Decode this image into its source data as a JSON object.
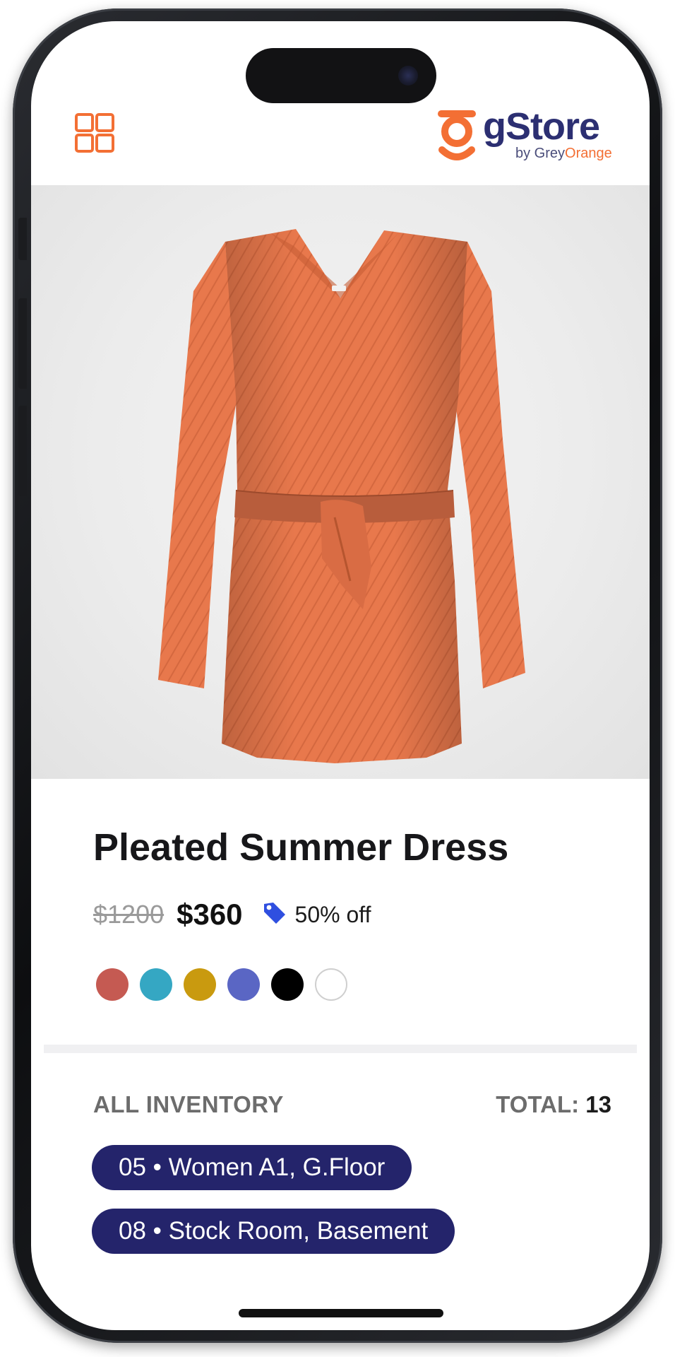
{
  "header": {
    "menu_icon": "grid-icon",
    "logo": {
      "wordmark": "gStore",
      "sub_prefix": "by Grey",
      "sub_brand": "Orange"
    }
  },
  "product": {
    "title": "Pleated Summer Dress",
    "original_price": "$1200",
    "price": "$360",
    "discount_icon": "tag-icon",
    "discount": "50% off",
    "colors": [
      "#c55a52",
      "#35a7c3",
      "#c99a0f",
      "#5a66c4",
      "#000000",
      "#ffffff"
    ]
  },
  "inventory": {
    "label": "ALL INVENTORY",
    "total_label": "TOTAL:",
    "total_value": "13",
    "locations": [
      "05 • Women A1, G.Floor",
      "08 • Stock Room, Basement"
    ]
  },
  "colors": {
    "accent": "#f36f34",
    "brand_navy": "#2c2f72",
    "pill": "#24246b"
  }
}
